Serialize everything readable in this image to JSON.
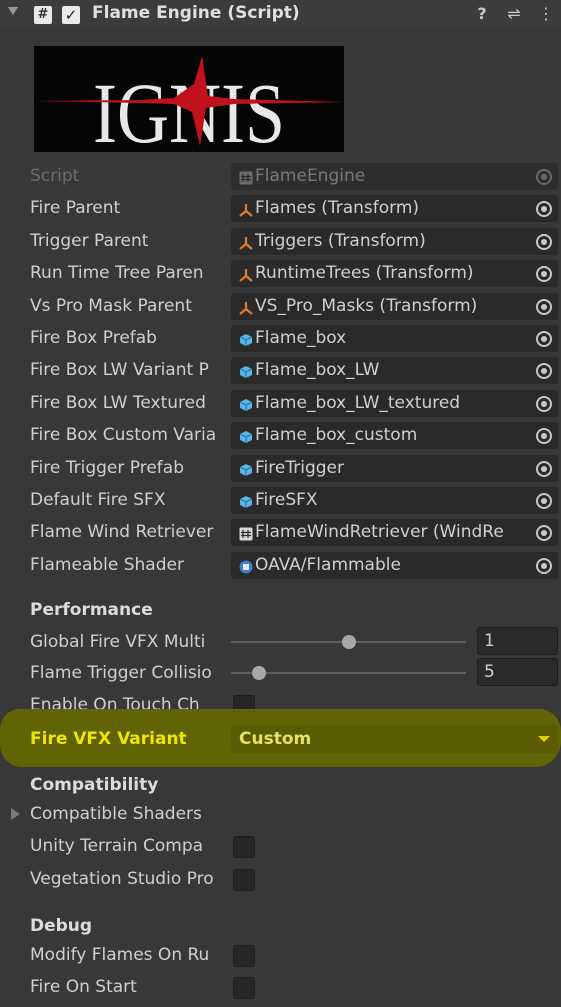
{
  "header": {
    "title": "Flame Engine (Script)",
    "hash_icon": "#",
    "check_icon": "✓",
    "help_icon": "?",
    "settings_icon": "⇌",
    "menu_icon": "⋮"
  },
  "logo": {
    "text": "IGNIS",
    "text_color": "#e8e8e8",
    "accent_color": "#c0121a"
  },
  "properties": [
    {
      "label": "Script",
      "value": "FlameEngine",
      "icon": "script-icon",
      "dim": true
    },
    {
      "label": "Fire Parent",
      "value": "Flames (Transform)",
      "icon": "transform-icon"
    },
    {
      "label": "Trigger Parent",
      "value": "Triggers (Transform)",
      "icon": "transform-icon"
    },
    {
      "label": "Run Time Tree Paren",
      "value": "RuntimeTrees (Transform)",
      "icon": "transform-icon"
    },
    {
      "label": "Vs Pro Mask Parent",
      "value": "VS_Pro_Masks (Transform)",
      "icon": "transform-icon"
    },
    {
      "label": "Fire Box Prefab",
      "value": "Flame_box",
      "icon": "prefab-icon"
    },
    {
      "label": "Fire Box LW Variant P",
      "value": "Flame_box_LW",
      "icon": "prefab-icon"
    },
    {
      "label": "Fire Box LW Textured",
      "value": "Flame_box_LW_textured",
      "icon": "prefab-icon"
    },
    {
      "label": "Fire Box Custom Varia",
      "value": "Flame_box_custom",
      "icon": "prefab-icon"
    },
    {
      "label": "Fire Trigger Prefab",
      "value": "FireTrigger",
      "icon": "prefab-icon"
    },
    {
      "label": "Default Fire SFX",
      "value": "FireSFX",
      "icon": "prefab-icon"
    },
    {
      "label": "Flame Wind Retriever",
      "value": "FlameWindRetriever (WindRe",
      "icon": "script-icon"
    },
    {
      "label": "Flameable Shader",
      "value": "OAVA/Flammable",
      "icon": "shader-icon"
    }
  ],
  "performance": {
    "title": "Performance",
    "global_vfx": {
      "label": "Global Fire VFX Multi",
      "value": "1",
      "fraction": 0.5
    },
    "trigger_collision": {
      "label": "Flame Trigger Collisio",
      "value": "5",
      "fraction": 0.1
    },
    "touch_check": {
      "label": "Enable On Touch Ch",
      "checked": false
    },
    "vfx_variant": {
      "label": "Fire VFX Variant",
      "value": "Custom"
    }
  },
  "compatibility": {
    "title": "Compatibility",
    "shaders_label": "Compatible Shaders",
    "terrain": {
      "label": "Unity Terrain Compa",
      "checked": false
    },
    "vegetation": {
      "label": "Vegetation Studio Pro",
      "checked": false
    }
  },
  "debug": {
    "title": "Debug",
    "modify_flames": {
      "label": "Modify Flames On Ru",
      "checked": false
    },
    "fire_on_start": {
      "label": "Fire On Start",
      "checked": false
    }
  },
  "colors": {
    "background": "#383838",
    "highlight": "#636602",
    "transform_icon": "#e07b2e",
    "prefab_icon": "#5ab4e8"
  }
}
